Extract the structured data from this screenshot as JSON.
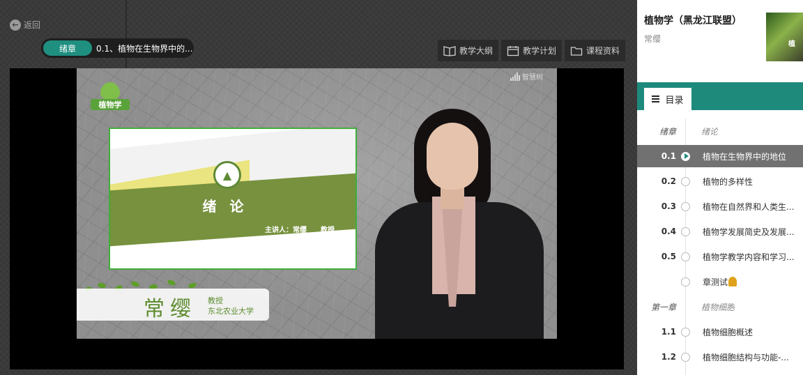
{
  "nav": {
    "back_label": "返回"
  },
  "breadcrumb": {
    "chapter": "绪章",
    "lesson": "0.1、植物在生物界中的..."
  },
  "toolbar": {
    "syllabus": "教学大纲",
    "plan": "教学计划",
    "materials": "课程资料"
  },
  "video": {
    "logo_text": "植物学",
    "watermark": "智慧树",
    "slide_title": "绪 论",
    "slide_lecturer": "主讲人：常缨　　教授",
    "name_big": "常缨",
    "name_role": "教授",
    "name_school": "东北农业大学"
  },
  "sidebar": {
    "course_title": "植物学（黑龙江联盟）",
    "teacher": "常缨",
    "thumb_text": "植",
    "tab_label": "目录",
    "accent": "#1e8a7c",
    "toc": [
      {
        "num": "绪章",
        "label": "绪论",
        "kind": "chapter"
      },
      {
        "num": "0.1",
        "label": "植物在生物界中的地位",
        "kind": "lesson",
        "active": true
      },
      {
        "num": "0.2",
        "label": "植物的多样性",
        "kind": "lesson"
      },
      {
        "num": "0.3",
        "label": "植物在自然界和人类生...",
        "kind": "lesson"
      },
      {
        "num": "0.4",
        "label": "植物学发展简史及发展...",
        "kind": "lesson"
      },
      {
        "num": "0.5",
        "label": "植物学教学内容和学习...",
        "kind": "lesson"
      },
      {
        "num": "",
        "label": "章测试",
        "kind": "test"
      },
      {
        "num": "第一章",
        "label": "植物细胞",
        "kind": "chapter"
      },
      {
        "num": "1.1",
        "label": "植物细胞概述",
        "kind": "lesson"
      },
      {
        "num": "1.2",
        "label": "植物细胞结构与功能-...",
        "kind": "lesson"
      }
    ]
  }
}
